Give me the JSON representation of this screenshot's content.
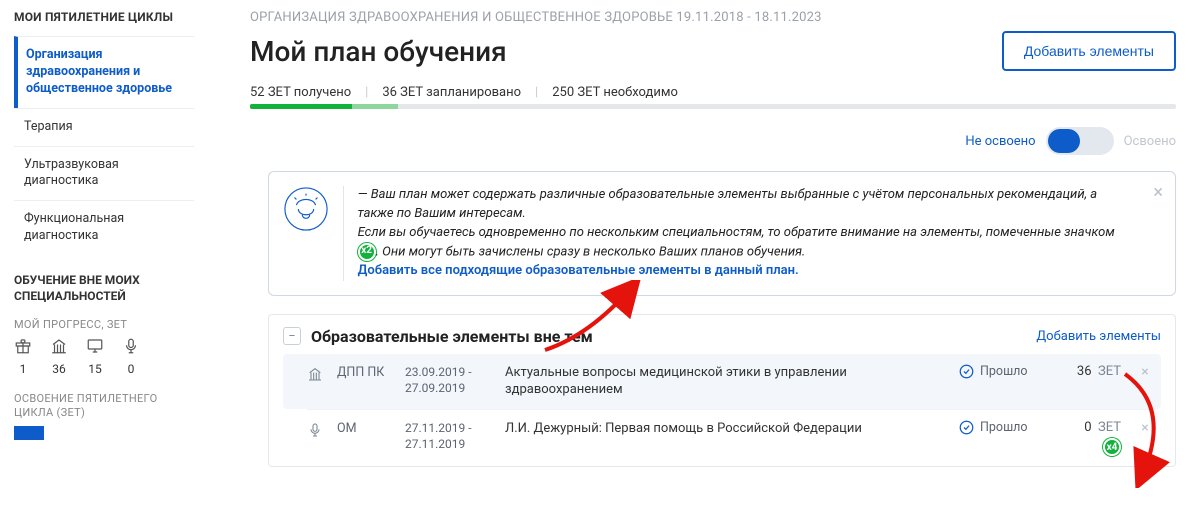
{
  "sidebar": {
    "title": "МОИ ПЯТИЛЕТНИЕ ЦИКЛЫ",
    "items": [
      {
        "label": "Организация здравоохранения и общественное здоровье"
      },
      {
        "label": "Терапия"
      },
      {
        "label": "Ультразвуковая диагностика"
      },
      {
        "label": "Функциональная диагностика"
      }
    ],
    "section2": "ОБУЧЕНИЕ ВНЕ МОИХ СПЕЦИАЛЬНОСТЕЙ",
    "progress_label": "МОЙ ПРОГРЕСС, ЗЕТ",
    "progress": [
      {
        "value": "1"
      },
      {
        "value": "36"
      },
      {
        "value": "15"
      },
      {
        "value": "0"
      }
    ],
    "cycle_label": "ОСВОЕНИЕ ПЯТИЛЕТНЕГО ЦИКЛА (ЗЕТ)"
  },
  "main": {
    "breadcrumb": "ОРГАНИЗАЦИЯ ЗДРАВООХРАНЕНИЯ И ОБЩЕСТВЕННОЕ ЗДОРОВЬЕ 19.11.2018 - 18.11.2023",
    "title": "Мой план обучения",
    "add_btn": "Добавить элементы",
    "zet": {
      "received": "52 ЗЕТ получено",
      "planned": "36 ЗЕТ запланировано",
      "needed": "250 ЗЕТ необходимо"
    },
    "toggle": {
      "on": "Не освоено",
      "off": "Освоено"
    },
    "callout": {
      "line1a": "— Ваш план может содержать различные образовательные элементы выбранные с учётом персональных рекомендаций, а также по Вашим интересам.",
      "line2a": "Если вы обучаетесь одновременно по нескольким специальностям, то обратите внимание на элементы, помеченные значком",
      "line2b": ". Они могут быть зачислены сразу в несколько Ваших планов обучения.",
      "badge": "x2",
      "link": "Добавить все подходящие образовательные элементы в данный план."
    },
    "panel": {
      "title": "Образовательные элементы вне тем",
      "add": "Добавить элементы",
      "rows": [
        {
          "code": "ДПП ПК",
          "dates": "23.09.2019 - 27.09.2019",
          "desc": "Актуальные вопросы медицинской этики в управлении здравоохранением",
          "status": "Прошло",
          "zet": "36",
          "unit": "ЗЕТ"
        },
        {
          "code": "ОМ",
          "dates": "27.11.2019 - 27.11.2019",
          "desc": "Л.И. Дежурный: Первая помощь в Российской Федерации",
          "status": "Прошло",
          "zet": "0",
          "unit": "ЗЕТ",
          "badge": "x4"
        }
      ]
    }
  }
}
